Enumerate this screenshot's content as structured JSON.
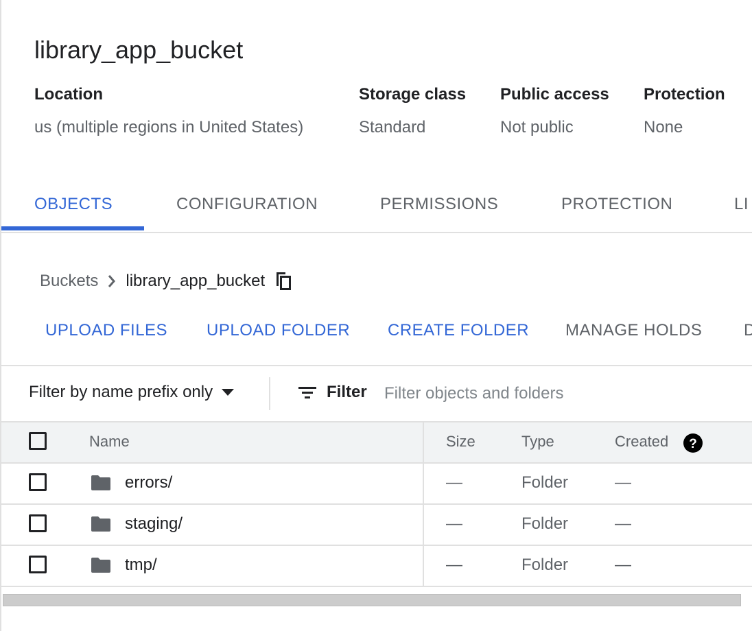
{
  "bucket": {
    "title": "library_app_bucket"
  },
  "meta": [
    {
      "label": "Location",
      "value": "us (multiple regions in United States)"
    },
    {
      "label": "Storage class",
      "value": "Standard"
    },
    {
      "label": "Public access",
      "value": "Not public"
    },
    {
      "label": "Protection",
      "value": "None"
    }
  ],
  "tabs": [
    {
      "label": "OBJECTS",
      "active": true
    },
    {
      "label": "CONFIGURATION",
      "active": false
    },
    {
      "label": "PERMISSIONS",
      "active": false
    },
    {
      "label": "PROTECTION",
      "active": false
    },
    {
      "label": "LI",
      "active": false
    }
  ],
  "breadcrumb": {
    "root": "Buckets",
    "current": "library_app_bucket",
    "separator_icon": "chevron-right-icon",
    "copy_icon": "copy-icon"
  },
  "actions": [
    {
      "label": "UPLOAD FILES",
      "enabled": true
    },
    {
      "label": "UPLOAD FOLDER",
      "enabled": true
    },
    {
      "label": "CREATE FOLDER",
      "enabled": true
    },
    {
      "label": "MANAGE HOLDS",
      "enabled": false
    },
    {
      "label": "D",
      "enabled": false
    }
  ],
  "filter": {
    "mode_label": "Filter by name prefix only",
    "button_label": "Filter",
    "placeholder": "Filter objects and folders"
  },
  "table": {
    "columns": [
      "Name",
      "Size",
      "Type",
      "Created"
    ],
    "rows": [
      {
        "name": "errors/",
        "size": "—",
        "type": "Folder",
        "created": "—"
      },
      {
        "name": "staging/",
        "size": "—",
        "type": "Folder",
        "created": "—"
      },
      {
        "name": "tmp/",
        "size": "—",
        "type": "Folder",
        "created": "—"
      }
    ]
  },
  "colors": {
    "accent": "#3367d6",
    "text": "#202124",
    "muted": "#5f6368",
    "divider": "#e0e0e0",
    "header_bg": "#f1f3f4",
    "folder": "#5f6368"
  }
}
